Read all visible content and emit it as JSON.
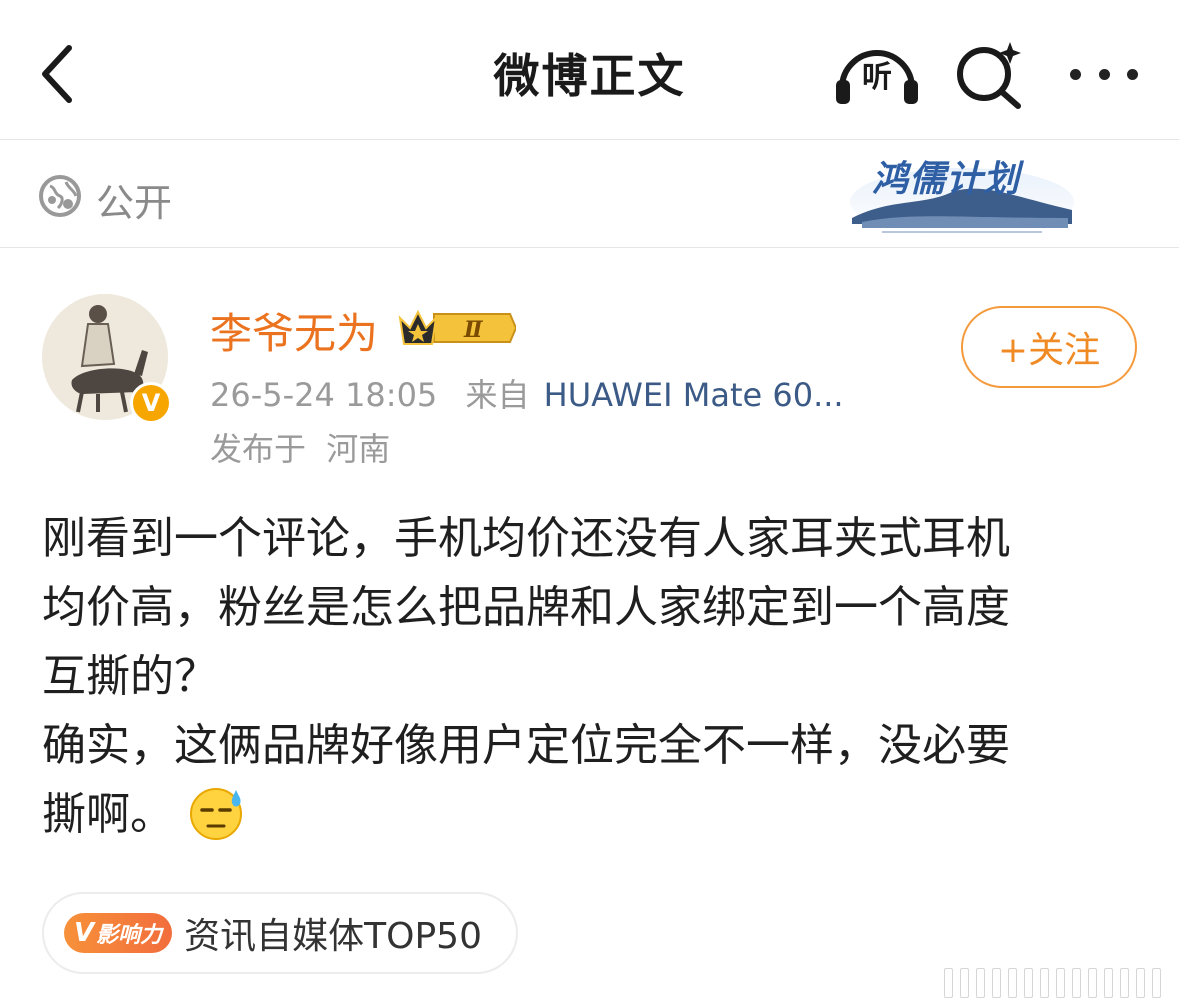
{
  "header": {
    "title": "微博正文",
    "listen_label": "听",
    "back_icon": "chevron-left-icon",
    "search_icon": "search-sparkle-icon",
    "more_icon": "more-horizontal-icon"
  },
  "visibility": {
    "label": "公开",
    "icon": "globe-icon"
  },
  "plan_badge": {
    "title": "鸿儒计划"
  },
  "author": {
    "name": "李爷无为",
    "level_badge": "Ⅱ",
    "verified_mark": "V",
    "follow_label": "+关注",
    "time": "26-5-24 18:05",
    "from_prefix": "来自",
    "device": "HUAWEI Mate 60...",
    "location_prefix": "发布于",
    "location": "河南"
  },
  "post": {
    "lines": [
      "刚看到一个评论，手机均价还没有人家耳夹式耳机",
      "均价高，粉丝是怎么把品牌和人家绑定到一个高度",
      "互撕的？",
      "确实，这俩品牌好像用户定位完全不一样，没必要",
      "撕啊。"
    ],
    "emoji": "sweat-emoji"
  },
  "influence": {
    "badge_label": "影响力",
    "badge_v": "V",
    "text": "资讯自媒体TOP50"
  },
  "colors": {
    "accent": "#eb7320",
    "link": "#3b5a86",
    "muted": "#9a9a9a"
  }
}
